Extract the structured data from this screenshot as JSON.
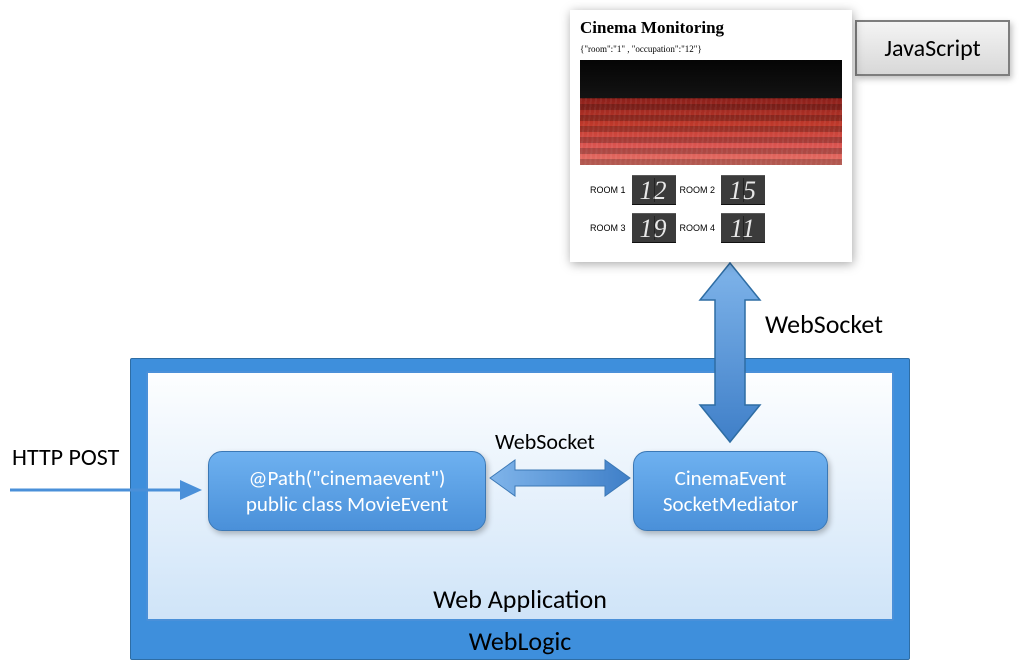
{
  "containers": {
    "weblogic_label": "WebLogic",
    "webapp_label": "Web Application"
  },
  "nodes": {
    "path_line1": "@Path(\"cinemaevent\")",
    "path_line2": "public class MovieEvent",
    "socket_line1": "CinemaEvent",
    "socket_line2": "SocketMediator"
  },
  "labels": {
    "http_post": "HTTP POST",
    "websocket_mid": "WebSocket",
    "websocket_top": "WebSocket",
    "javascript": "JavaScript"
  },
  "cinema": {
    "title": "Cinema Monitoring",
    "json_snippet": "{\"room\":\"1\" , \"occupation\":\"12\"}",
    "rooms": [
      {
        "label": "ROOM 1",
        "value": "12"
      },
      {
        "label": "ROOM 2",
        "value": "15"
      },
      {
        "label": "ROOM 3",
        "value": "19"
      },
      {
        "label": "ROOM 4",
        "value": "11"
      }
    ]
  },
  "colors": {
    "node_blue": "#4a90d9",
    "container_blue": "#3e8fdc",
    "arrow_blue": "#5a9bd5"
  }
}
